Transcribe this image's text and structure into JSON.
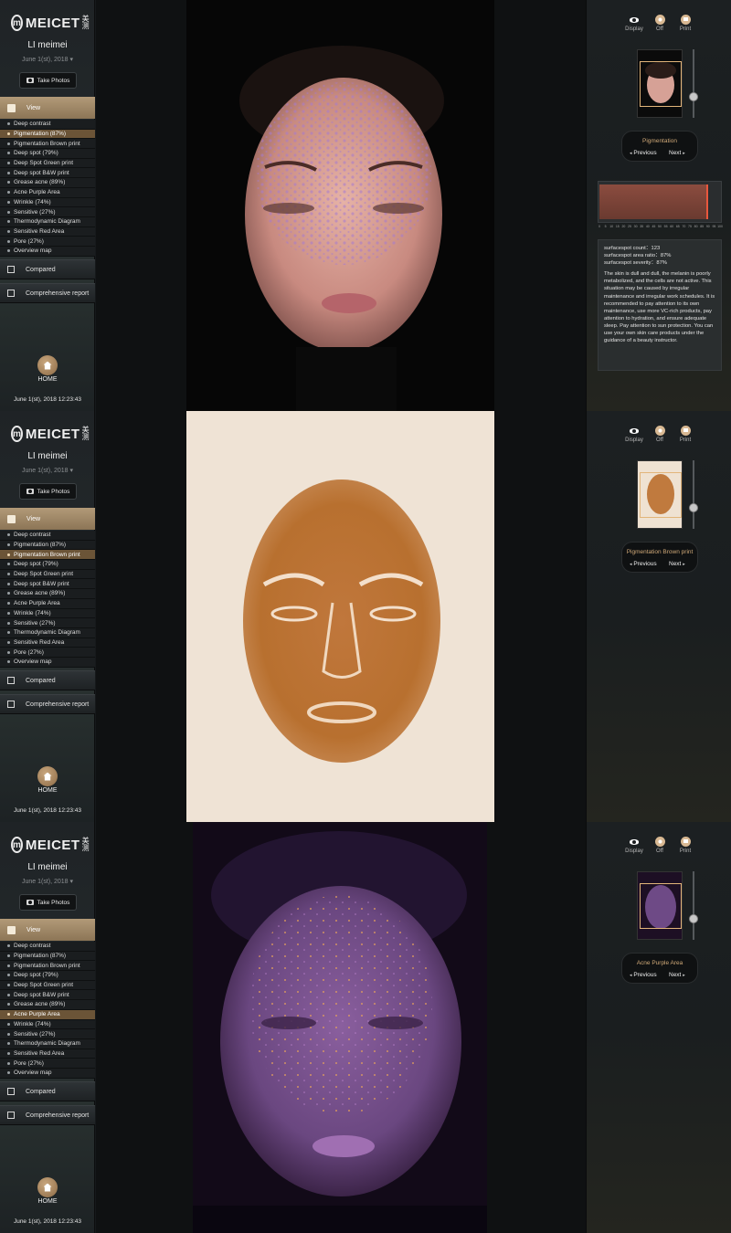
{
  "brand": {
    "name": "MEICET",
    "cn": "美测"
  },
  "user": {
    "name": "LI meimei",
    "date": "June 1(st), 2018 ▾"
  },
  "take_photos": "Take Photos",
  "view_label": "View",
  "menu": [
    "Deep contrast",
    "Pigmentation  (87%)",
    "Pigmentation Brown print",
    "Deep spot  (79%)",
    "Deep Spot Green print",
    "Deep spot B&W print",
    "Grease acne  (89%)",
    "Acne Purple Area",
    "Wrinkle  (74%)",
    "Sensitive  (27%)",
    "Thermodynamic Diagram",
    "Sensitive Red Area",
    "Pore  (27%)",
    "Overview map"
  ],
  "compared": "Compared",
  "report": "Comprehensive report",
  "home": "HOME",
  "timestamp": "June 1(st), 2018 12:23:43",
  "toolbar": {
    "display": "Display",
    "off": "Off",
    "print": "Print"
  },
  "nav": {
    "previous": "Previous",
    "next": "Next"
  },
  "panels": [
    {
      "active_index": 1,
      "title": "Pigmentation",
      "slider_level": 0.73
    },
    {
      "active_index": 2,
      "title": "Pigmentation Brown print",
      "slider_level": 0.73
    },
    {
      "active_index": 7,
      "title": "Acne Purple Area",
      "slider_level": 0.73
    }
  ],
  "histogram": {
    "value_percent": 87,
    "ticks": [
      "0",
      "5",
      "10",
      "15",
      "20",
      "25",
      "30",
      "35",
      "40",
      "45",
      "50",
      "55",
      "60",
      "65",
      "70",
      "75",
      "80",
      "85",
      "90",
      "95",
      "100"
    ]
  },
  "stats": {
    "count": "surfacespot count：123",
    "ratio": "surfacespot area ratio：87%",
    "severity": "surfacespot severity：87%",
    "advice": "The skin is dull and dull, the melanin is poorly metabolized, and the cells are not active. This situation may be caused by irregular maintenance and irregular work schedules. It is recommended to pay attention to its own maintenance, use more VC-rich products, pay attention to hydration, and ensure adequate sleep. Pay attention to sun protection. You can use your own skin care products under the guidance of a beauty instructor."
  },
  "colors": {
    "accent": "#d0a978",
    "active_menu": "#6b5437",
    "view_bar": "#a48b69"
  }
}
